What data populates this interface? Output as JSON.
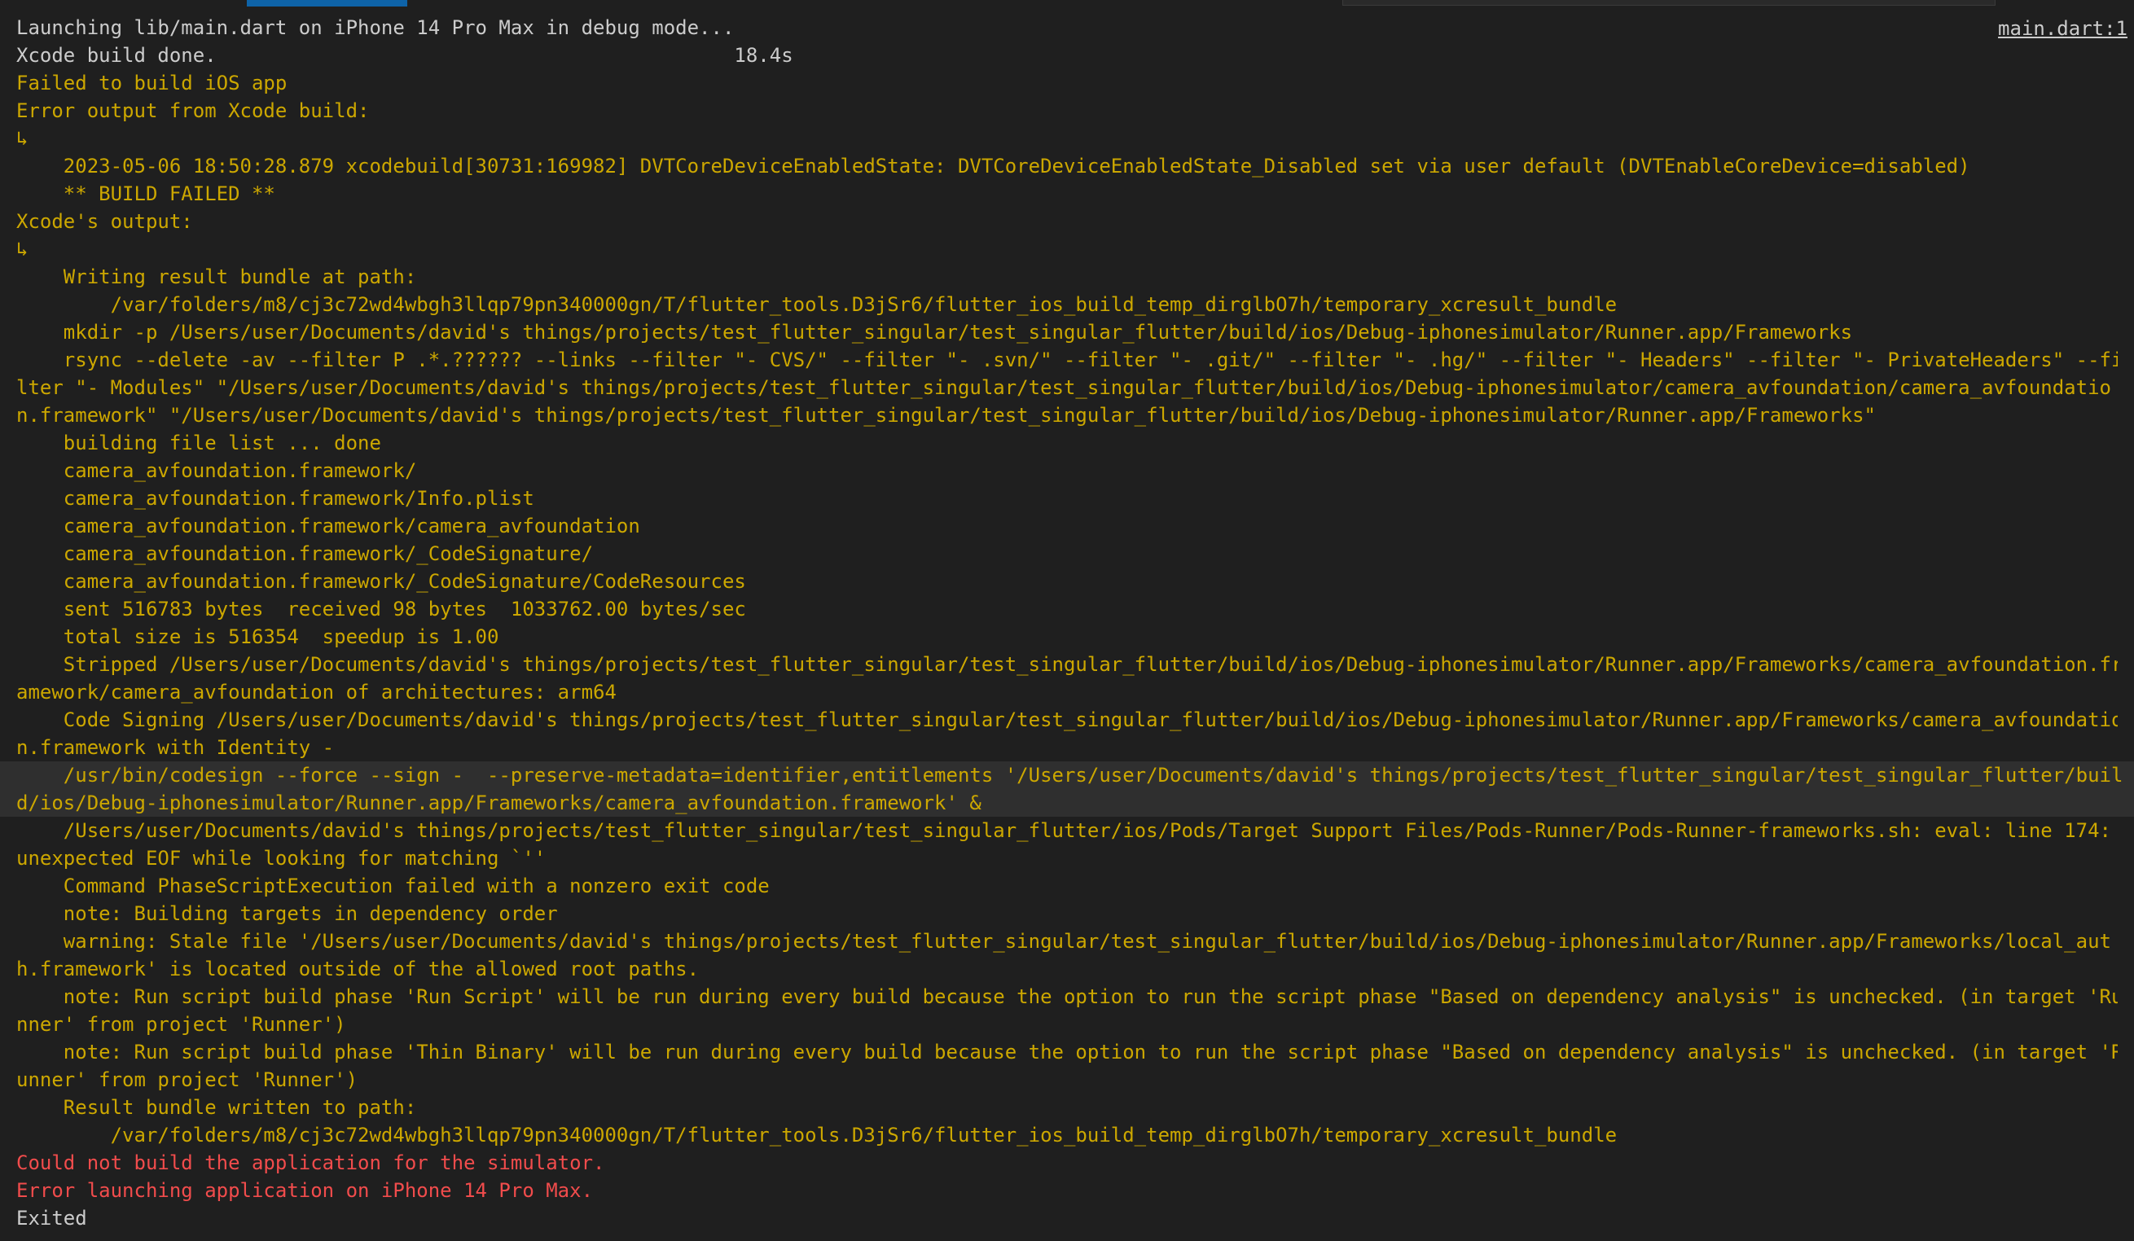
{
  "header": {
    "file_link": "main.dart:1"
  },
  "colors": {
    "background": "#1f1f1f",
    "default_text": "#cccccc",
    "warning_text": "#cca700",
    "error_text": "#f14c4c",
    "selected_line": "#2f2f2f",
    "tab_indicator": "#0e63a8"
  },
  "console": {
    "lines": [
      {
        "text": "Launching lib/main.dart on iPhone 14 Pro Max in debug mode...",
        "style": "out"
      },
      {
        "text": "Xcode build done.                                            18.4s",
        "style": "out"
      },
      {
        "text": "Failed to build iOS app",
        "style": "warn"
      },
      {
        "text": "Error output from Xcode build:",
        "style": "warn"
      },
      {
        "text": "↳",
        "style": "warn"
      },
      {
        "text": "    2023-05-06 18:50:28.879 xcodebuild[30731:169982] DVTCoreDeviceEnabledState: DVTCoreDeviceEnabledState_Disabled set via user default (DVTEnableCoreDevice=disabled)",
        "style": "warn"
      },
      {
        "text": "    ** BUILD FAILED **",
        "style": "warn"
      },
      {
        "text": "Xcode's output:",
        "style": "warn"
      },
      {
        "text": "↳",
        "style": "warn"
      },
      {
        "text": "    Writing result bundle at path:",
        "style": "warn"
      },
      {
        "text": "        /var/folders/m8/cj3c72wd4wbgh3llqp79pn340000gn/T/flutter_tools.D3jSr6/flutter_ios_build_temp_dirglbO7h/temporary_xcresult_bundle",
        "style": "warn"
      },
      {
        "text": "    mkdir -p /Users/user/Documents/david's things/projects/test_flutter_singular/test_singular_flutter/build/ios/Debug-iphonesimulator/Runner.app/Frameworks",
        "style": "warn"
      },
      {
        "text": "    rsync --delete -av --filter P .*.?????? --links --filter \"- CVS/\" --filter \"- .svn/\" --filter \"- .git/\" --filter \"- .hg/\" --filter \"- Headers\" --filter \"- PrivateHeaders\" --fi",
        "style": "warn"
      },
      {
        "text": "lter \"- Modules\" \"/Users/user/Documents/david's things/projects/test_flutter_singular/test_singular_flutter/build/ios/Debug-iphonesimulator/camera_avfoundation/camera_avfoundatio",
        "style": "warn"
      },
      {
        "text": "n.framework\" \"/Users/user/Documents/david's things/projects/test_flutter_singular/test_singular_flutter/build/ios/Debug-iphonesimulator/Runner.app/Frameworks\"",
        "style": "warn"
      },
      {
        "text": "    building file list ... done",
        "style": "warn"
      },
      {
        "text": "    camera_avfoundation.framework/",
        "style": "warn"
      },
      {
        "text": "    camera_avfoundation.framework/Info.plist",
        "style": "warn"
      },
      {
        "text": "    camera_avfoundation.framework/camera_avfoundation",
        "style": "warn"
      },
      {
        "text": "    camera_avfoundation.framework/_CodeSignature/",
        "style": "warn"
      },
      {
        "text": "    camera_avfoundation.framework/_CodeSignature/CodeResources",
        "style": "warn"
      },
      {
        "text": "    sent 516783 bytes  received 98 bytes  1033762.00 bytes/sec",
        "style": "warn"
      },
      {
        "text": "    total size is 516354  speedup is 1.00",
        "style": "warn"
      },
      {
        "text": "    Stripped /Users/user/Documents/david's things/projects/test_flutter_singular/test_singular_flutter/build/ios/Debug-iphonesimulator/Runner.app/Frameworks/camera_avfoundation.fr",
        "style": "warn"
      },
      {
        "text": "amework/camera_avfoundation of architectures: arm64",
        "style": "warn"
      },
      {
        "text": "    Code Signing /Users/user/Documents/david's things/projects/test_flutter_singular/test_singular_flutter/build/ios/Debug-iphonesimulator/Runner.app/Frameworks/camera_avfoundatio",
        "style": "warn"
      },
      {
        "text": "n.framework with Identity -",
        "style": "warn"
      },
      {
        "text": "    /usr/bin/codesign --force --sign -  --preserve-metadata=identifier,entitlements '/Users/user/Documents/david's things/projects/test_flutter_singular/test_singular_flutter/buil",
        "style": "warn",
        "selected": true
      },
      {
        "text": "d/ios/Debug-iphonesimulator/Runner.app/Frameworks/camera_avfoundation.framework' &",
        "style": "warn",
        "selected": true
      },
      {
        "text": "    /Users/user/Documents/david's things/projects/test_flutter_singular/test_singular_flutter/ios/Pods/Target Support Files/Pods-Runner/Pods-Runner-frameworks.sh: eval: line 174:",
        "style": "warn"
      },
      {
        "text": "unexpected EOF while looking for matching `''",
        "style": "warn"
      },
      {
        "text": "    Command PhaseScriptExecution failed with a nonzero exit code",
        "style": "warn"
      },
      {
        "text": "    note: Building targets in dependency order",
        "style": "warn"
      },
      {
        "text": "    warning: Stale file '/Users/user/Documents/david's things/projects/test_flutter_singular/test_singular_flutter/build/ios/Debug-iphonesimulator/Runner.app/Frameworks/local_aut",
        "style": "warn"
      },
      {
        "text": "h.framework' is located outside of the allowed root paths.",
        "style": "warn"
      },
      {
        "text": "    note: Run script build phase 'Run Script' will be run during every build because the option to run the script phase \"Based on dependency analysis\" is unchecked. (in target 'Ru",
        "style": "warn"
      },
      {
        "text": "nner' from project 'Runner')",
        "style": "warn"
      },
      {
        "text": "    note: Run script build phase 'Thin Binary' will be run during every build because the option to run the script phase \"Based on dependency analysis\" is unchecked. (in target 'R",
        "style": "warn"
      },
      {
        "text": "unner' from project 'Runner')",
        "style": "warn"
      },
      {
        "text": "    Result bundle written to path:",
        "style": "warn"
      },
      {
        "text": "        /var/folders/m8/cj3c72wd4wbgh3llqp79pn340000gn/T/flutter_tools.D3jSr6/flutter_ios_build_temp_dirglbO7h/temporary_xcresult_bundle",
        "style": "warn"
      },
      {
        "text": "Could not build the application for the simulator.",
        "style": "err"
      },
      {
        "text": "Error launching application on iPhone 14 Pro Max.",
        "style": "err"
      },
      {
        "text": "Exited",
        "style": "out"
      }
    ]
  }
}
